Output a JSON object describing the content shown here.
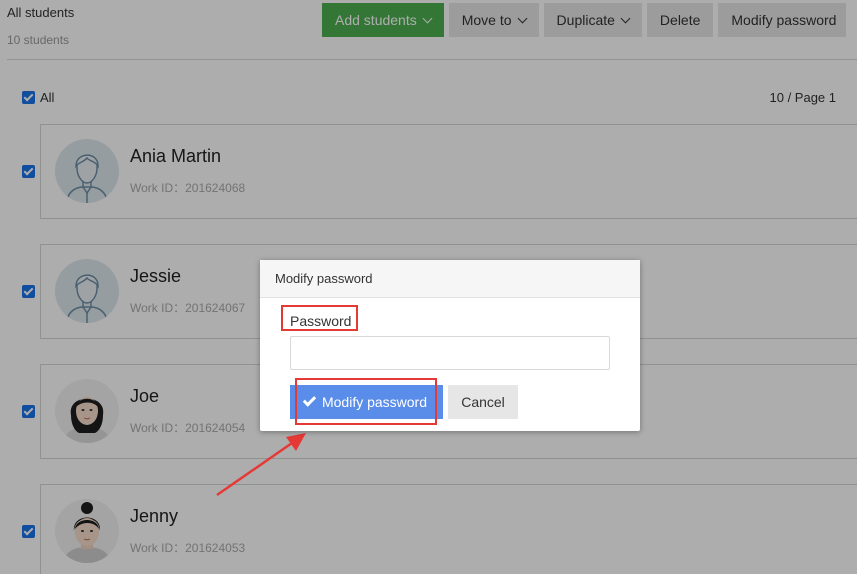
{
  "header": {
    "title": "All students",
    "count": "10 students"
  },
  "toolbar": {
    "add_students": "Add students",
    "move_to": "Move to",
    "duplicate": "Duplicate",
    "delete": "Delete",
    "modify_password": "Modify password"
  },
  "list": {
    "select_all_label": "All",
    "pager": "10 / Page 1"
  },
  "students": [
    {
      "name": "Ania Martin",
      "work_id": "Work ID：201624068",
      "avatar": "male-placeholder"
    },
    {
      "name": "Jessie",
      "work_id": "Work ID：201624067",
      "avatar": "male-placeholder"
    },
    {
      "name": "Joe",
      "work_id": "Work ID：201624054",
      "avatar": "female-photo"
    },
    {
      "name": "Jenny",
      "work_id": "Work ID：201624053",
      "avatar": "female-photo-bun"
    }
  ],
  "modal": {
    "title": "Modify password",
    "password_label": "Password",
    "password_value": "",
    "password_placeholder": "",
    "confirm_label": "Modify password",
    "cancel_label": "Cancel"
  },
  "colors": {
    "primary_green": "#4caf50",
    "confirm_blue": "#5a8de9",
    "checkbox_blue": "#1a73e8",
    "annotation_red": "#e53935"
  }
}
